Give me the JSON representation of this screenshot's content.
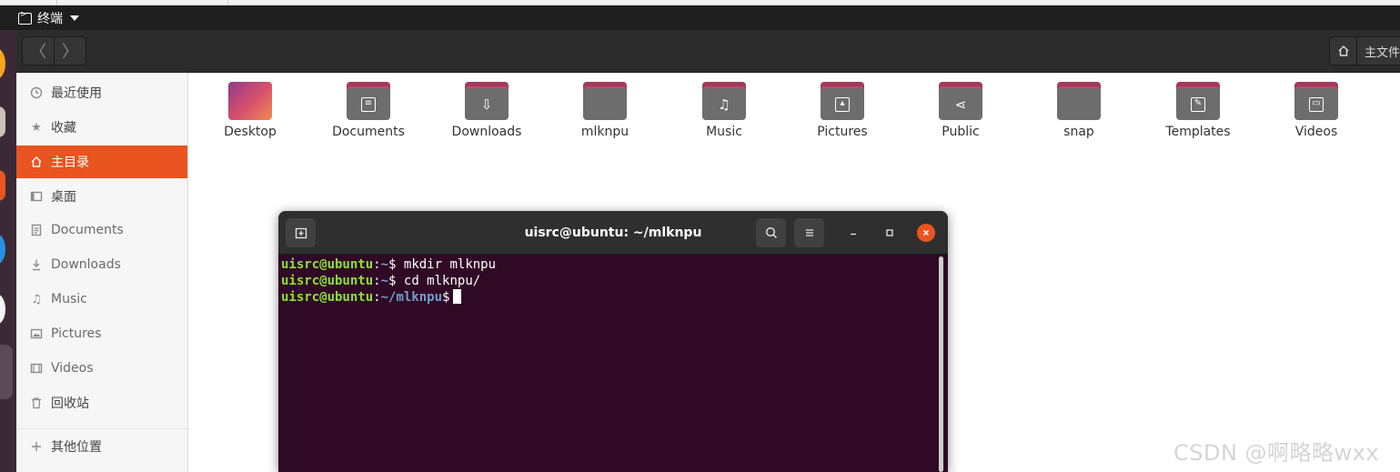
{
  "topbar": {
    "app_name": "终端"
  },
  "headerbar": {
    "back_glyph": "〈",
    "forward_glyph": "〉",
    "path_label": "主文件"
  },
  "sidebar": {
    "items": [
      {
        "label": "最近使用",
        "icon": "clock-icon"
      },
      {
        "label": "收藏",
        "icon": "star-icon"
      },
      {
        "label": "主目录",
        "icon": "home-icon",
        "active": true
      },
      {
        "label": "桌面",
        "icon": "desktop-icon"
      },
      {
        "label": "Documents",
        "icon": "document-icon"
      },
      {
        "label": "Downloads",
        "icon": "download-icon"
      },
      {
        "label": "Music",
        "icon": "music-icon"
      },
      {
        "label": "Pictures",
        "icon": "picture-icon"
      },
      {
        "label": "Videos",
        "icon": "video-icon"
      },
      {
        "label": "回收站",
        "icon": "trash-icon"
      },
      {
        "label": "其他位置",
        "icon": "plus-icon"
      }
    ]
  },
  "files": [
    {
      "label": "Desktop",
      "icon": "desktop-folder-icon"
    },
    {
      "label": "Documents",
      "icon": "documents-folder-icon"
    },
    {
      "label": "Downloads",
      "icon": "downloads-folder-icon"
    },
    {
      "label": "mlknpu",
      "icon": "folder-icon"
    },
    {
      "label": "Music",
      "icon": "music-folder-icon"
    },
    {
      "label": "Pictures",
      "icon": "pictures-folder-icon"
    },
    {
      "label": "Public",
      "icon": "public-folder-icon"
    },
    {
      "label": "snap",
      "icon": "folder-icon"
    },
    {
      "label": "Templates",
      "icon": "templates-folder-icon"
    },
    {
      "label": "Videos",
      "icon": "videos-folder-icon"
    }
  ],
  "terminal": {
    "title": "uisrc@ubuntu: ~/mlknpu",
    "lines": [
      {
        "user": "uisrc@ubuntu",
        "sep": ":",
        "path": "~",
        "prompt": "$ ",
        "command": "mkdir mlknpu"
      },
      {
        "user": "uisrc@ubuntu",
        "sep": ":",
        "path": "~",
        "prompt": "$ ",
        "command": "cd mlknpu/"
      },
      {
        "user": "uisrc@ubuntu",
        "sep": ":",
        "path": "~/mlknpu",
        "prompt": "$",
        "command": ""
      }
    ]
  },
  "watermark": "CSDN @啊略略wxx",
  "colors": {
    "accent": "#e95420",
    "terminal_bg": "#300a24",
    "prompt_user": "#8ae234",
    "prompt_path": "#729fcf"
  }
}
